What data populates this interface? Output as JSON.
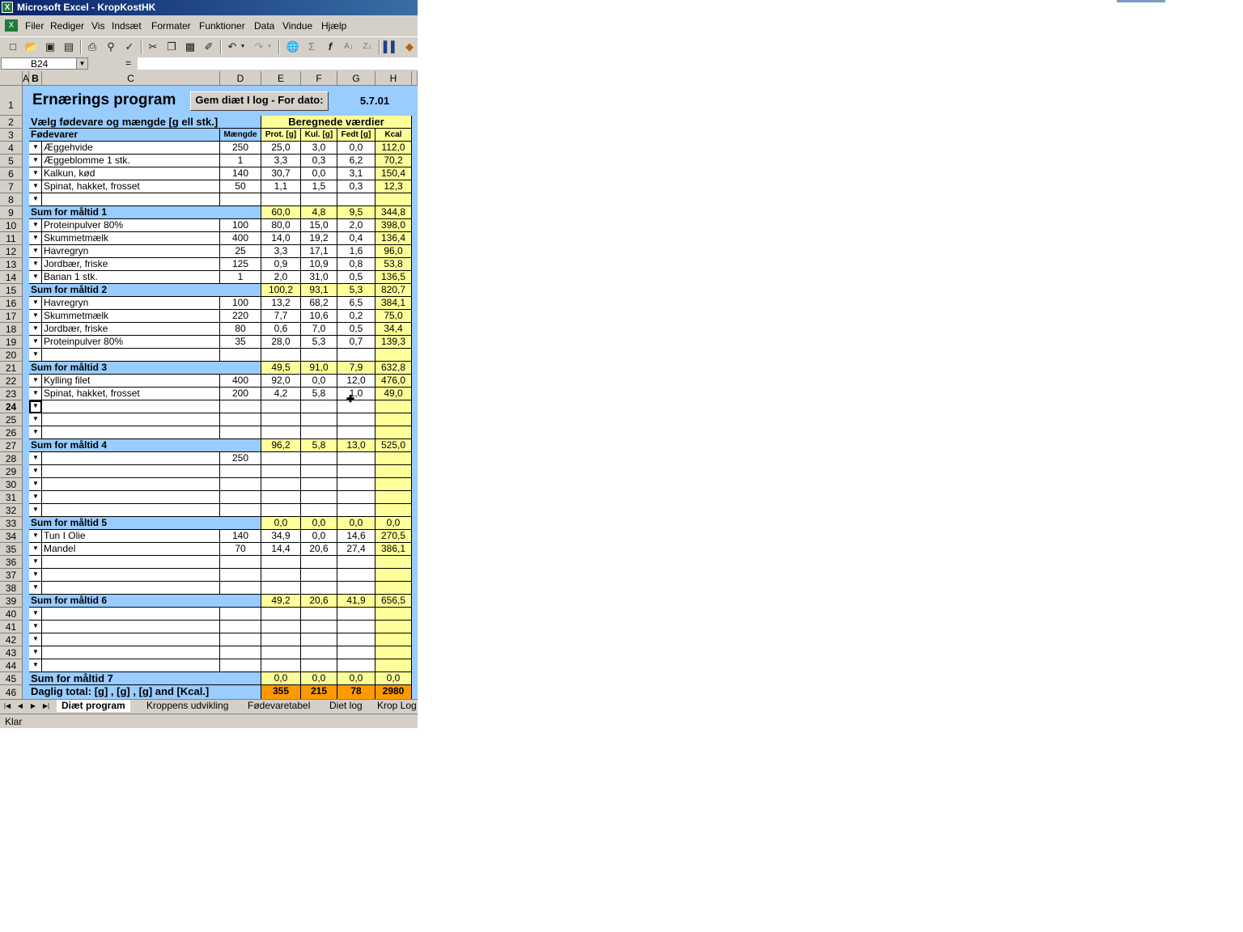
{
  "window": {
    "title": "Microsoft Excel - KropKostHK"
  },
  "menu": [
    "Filer",
    "Rediger",
    "Vis",
    "Indsæt",
    "Formater",
    "Funktioner",
    "Data",
    "Vindue",
    "Hjælp"
  ],
  "namebox": {
    "value": "B24"
  },
  "formula": {
    "eq": "=",
    "value": ""
  },
  "columns": [
    "A",
    "B",
    "C",
    "D",
    "E",
    "F",
    "G",
    "H"
  ],
  "sheet": {
    "title": "Ernærings program",
    "save_button": "Gem diæt I log - For dato:",
    "date": "5.7.01",
    "header_choose": "Vælg fødevare og mængde [g ell stk.]",
    "header_calc": "Beregnede værdier",
    "col_food": "Fødevarer",
    "col_qty": "Mængde",
    "col_prot": "Prot. [g]",
    "col_kul": "Kul. [g]",
    "col_fedt": "Fedt [g]",
    "col_kcal": "Kcal",
    "rows": [
      {
        "r": 4,
        "type": "item",
        "food": "Æggehvide",
        "qty": "250",
        "p": "25,0",
        "k": "3,0",
        "f": "0,0",
        "kcal": "112,0"
      },
      {
        "r": 5,
        "type": "item",
        "food": "Æggeblomme 1 stk.",
        "qty": "1",
        "p": "3,3",
        "k": "0,3",
        "f": "6,2",
        "kcal": "70,2"
      },
      {
        "r": 6,
        "type": "item",
        "food": "Kalkun, kød",
        "qty": "140",
        "p": "30,7",
        "k": "0,0",
        "f": "3,1",
        "kcal": "150,4"
      },
      {
        "r": 7,
        "type": "item",
        "food": "Spinat, hakket, frosset",
        "qty": "50",
        "p": "1,1",
        "k": "1,5",
        "f": "0,3",
        "kcal": "12,3"
      },
      {
        "r": 8,
        "type": "item",
        "food": "",
        "qty": "",
        "p": "",
        "k": "",
        "f": "",
        "kcal": ""
      },
      {
        "r": 9,
        "type": "sum",
        "food": "Sum for måltid 1",
        "p": "60,0",
        "k": "4,8",
        "f": "9,5",
        "kcal": "344,8"
      },
      {
        "r": 10,
        "type": "item",
        "food": "Proteinpulver 80%",
        "qty": "100",
        "p": "80,0",
        "k": "15,0",
        "f": "2,0",
        "kcal": "398,0"
      },
      {
        "r": 11,
        "type": "item",
        "food": "Skummetmælk",
        "qty": "400",
        "p": "14,0",
        "k": "19,2",
        "f": "0,4",
        "kcal": "136,4"
      },
      {
        "r": 12,
        "type": "item",
        "food": "Havregryn",
        "qty": "25",
        "p": "3,3",
        "k": "17,1",
        "f": "1,6",
        "kcal": "96,0"
      },
      {
        "r": 13,
        "type": "item",
        "food": "Jordbær, friske",
        "qty": "125",
        "p": "0,9",
        "k": "10,9",
        "f": "0,8",
        "kcal": "53,8"
      },
      {
        "r": 14,
        "type": "item",
        "food": "Banan 1 stk.",
        "qty": "1",
        "p": "2,0",
        "k": "31,0",
        "f": "0,5",
        "kcal": "136,5"
      },
      {
        "r": 15,
        "type": "sum",
        "food": "Sum for måltid 2",
        "p": "100,2",
        "k": "93,1",
        "f": "5,3",
        "kcal": "820,7"
      },
      {
        "r": 16,
        "type": "item",
        "food": "Havregryn",
        "qty": "100",
        "p": "13,2",
        "k": "68,2",
        "f": "6,5",
        "kcal": "384,1"
      },
      {
        "r": 17,
        "type": "item",
        "food": "Skummetmælk",
        "qty": "220",
        "p": "7,7",
        "k": "10,6",
        "f": "0,2",
        "kcal": "75,0"
      },
      {
        "r": 18,
        "type": "item",
        "food": "Jordbær, friske",
        "qty": "80",
        "p": "0,6",
        "k": "7,0",
        "f": "0,5",
        "kcal": "34,4"
      },
      {
        "r": 19,
        "type": "item",
        "food": "Proteinpulver 80%",
        "qty": "35",
        "p": "28,0",
        "k": "5,3",
        "f": "0,7",
        "kcal": "139,3"
      },
      {
        "r": 20,
        "type": "item",
        "food": "",
        "qty": "",
        "p": "",
        "k": "",
        "f": "",
        "kcal": ""
      },
      {
        "r": 21,
        "type": "sum",
        "food": "Sum for måltid 3",
        "p": "49,5",
        "k": "91,0",
        "f": "7,9",
        "kcal": "632,8"
      },
      {
        "r": 22,
        "type": "item",
        "food": "Kylling filet",
        "qty": "400",
        "p": "92,0",
        "k": "0,0",
        "f": "12,0",
        "kcal": "476,0"
      },
      {
        "r": 23,
        "type": "item",
        "food": "Spinat, hakket, frosset",
        "qty": "200",
        "p": "4,2",
        "k": "5,8",
        "f": "1,0",
        "kcal": "49,0"
      },
      {
        "r": 24,
        "type": "item",
        "food": "",
        "qty": "",
        "p": "",
        "k": "",
        "f": "",
        "kcal": ""
      },
      {
        "r": 25,
        "type": "item",
        "food": "",
        "qty": "",
        "p": "",
        "k": "",
        "f": "",
        "kcal": ""
      },
      {
        "r": 26,
        "type": "item",
        "food": "",
        "qty": "",
        "p": "",
        "k": "",
        "f": "",
        "kcal": ""
      },
      {
        "r": 27,
        "type": "sum",
        "food": "Sum for måltid 4",
        "p": "96,2",
        "k": "5,8",
        "f": "13,0",
        "kcal": "525,0"
      },
      {
        "r": 28,
        "type": "item",
        "food": "",
        "qty": "250",
        "p": "",
        "k": "",
        "f": "",
        "kcal": ""
      },
      {
        "r": 29,
        "type": "item",
        "food": "",
        "qty": "",
        "p": "",
        "k": "",
        "f": "",
        "kcal": ""
      },
      {
        "r": 30,
        "type": "item",
        "food": "",
        "qty": "",
        "p": "",
        "k": "",
        "f": "",
        "kcal": ""
      },
      {
        "r": 31,
        "type": "item",
        "food": "",
        "qty": "",
        "p": "",
        "k": "",
        "f": "",
        "kcal": ""
      },
      {
        "r": 32,
        "type": "item",
        "food": "",
        "qty": "",
        "p": "",
        "k": "",
        "f": "",
        "kcal": ""
      },
      {
        "r": 33,
        "type": "sum",
        "food": "Sum for måltid 5",
        "p": "0,0",
        "k": "0,0",
        "f": "0,0",
        "kcal": "0,0"
      },
      {
        "r": 34,
        "type": "item",
        "food": "Tun I Olie",
        "qty": "140",
        "p": "34,9",
        "k": "0,0",
        "f": "14,6",
        "kcal": "270,5"
      },
      {
        "r": 35,
        "type": "item",
        "food": "Mandel",
        "qty": "70",
        "p": "14,4",
        "k": "20,6",
        "f": "27,4",
        "kcal": "386,1"
      },
      {
        "r": 36,
        "type": "item",
        "food": "",
        "qty": "",
        "p": "",
        "k": "",
        "f": "",
        "kcal": ""
      },
      {
        "r": 37,
        "type": "item",
        "food": "",
        "qty": "",
        "p": "",
        "k": "",
        "f": "",
        "kcal": ""
      },
      {
        "r": 38,
        "type": "item",
        "food": "",
        "qty": "",
        "p": "",
        "k": "",
        "f": "",
        "kcal": ""
      },
      {
        "r": 39,
        "type": "sum",
        "food": "Sum for måltid 6",
        "p": "49,2",
        "k": "20,6",
        "f": "41,9",
        "kcal": "656,5"
      },
      {
        "r": 40,
        "type": "item",
        "food": "",
        "qty": "",
        "p": "",
        "k": "",
        "f": "",
        "kcal": ""
      },
      {
        "r": 41,
        "type": "item",
        "food": "",
        "qty": "",
        "p": "",
        "k": "",
        "f": "",
        "kcal": ""
      },
      {
        "r": 42,
        "type": "item",
        "food": "",
        "qty": "",
        "p": "",
        "k": "",
        "f": "",
        "kcal": ""
      },
      {
        "r": 43,
        "type": "item",
        "food": "",
        "qty": "",
        "p": "",
        "k": "",
        "f": "",
        "kcal": ""
      },
      {
        "r": 44,
        "type": "item",
        "food": "",
        "qty": "",
        "p": "",
        "k": "",
        "f": "",
        "kcal": ""
      },
      {
        "r": 45,
        "type": "sum",
        "food": "Sum for måltid 7",
        "p": "0,0",
        "k": "0,0",
        "f": "0,0",
        "kcal": "0,0"
      },
      {
        "r": 46,
        "type": "total",
        "food": "Daglig total: [g] , [g] , [g] and [Kcal.]",
        "p": "355",
        "k": "215",
        "f": "78",
        "kcal": "2980"
      }
    ]
  },
  "tabs": [
    "Diæt program",
    "Kroppens udvikling",
    "Fødevaretabel",
    "Diet log",
    "Krop Log"
  ],
  "active_tab": "Diæt program",
  "status": "Klar",
  "colors": {
    "blue": "#99ccff",
    "yellow": "#ffff99",
    "orange": "#ff9900",
    "title_bar": "#0a246a"
  }
}
